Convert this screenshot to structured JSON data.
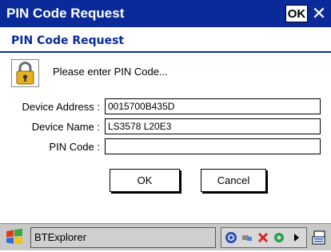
{
  "window": {
    "title": "PIN Code Request",
    "ok_label": "OK",
    "close_glyph": "✕"
  },
  "dialog": {
    "title": "PIN Code Request",
    "icon": "padlock-icon",
    "prompt": "Please enter PIN Code...",
    "fields": [
      {
        "label": "Device Address :",
        "value": "0015700B435D"
      },
      {
        "label": "Device Name :",
        "value": "LS3578 L20E3"
      },
      {
        "label": "PIN Code :",
        "value": ""
      }
    ],
    "ok_button": "OK",
    "cancel_button": "Cancel"
  },
  "taskbar": {
    "start_icon": "windows-flag-icon",
    "app_label": "BTExplorer",
    "tray_icons": [
      "bluetooth-icon",
      "network-icon",
      "connection-error-icon",
      "sync-icon",
      "tray-arrow-icon"
    ],
    "keyboard_icon": "input-panel-icon"
  },
  "colors": {
    "title_bar": "#0a2a99",
    "dialog_title": "#0a2a99",
    "taskbar": "#c9c9c9"
  }
}
